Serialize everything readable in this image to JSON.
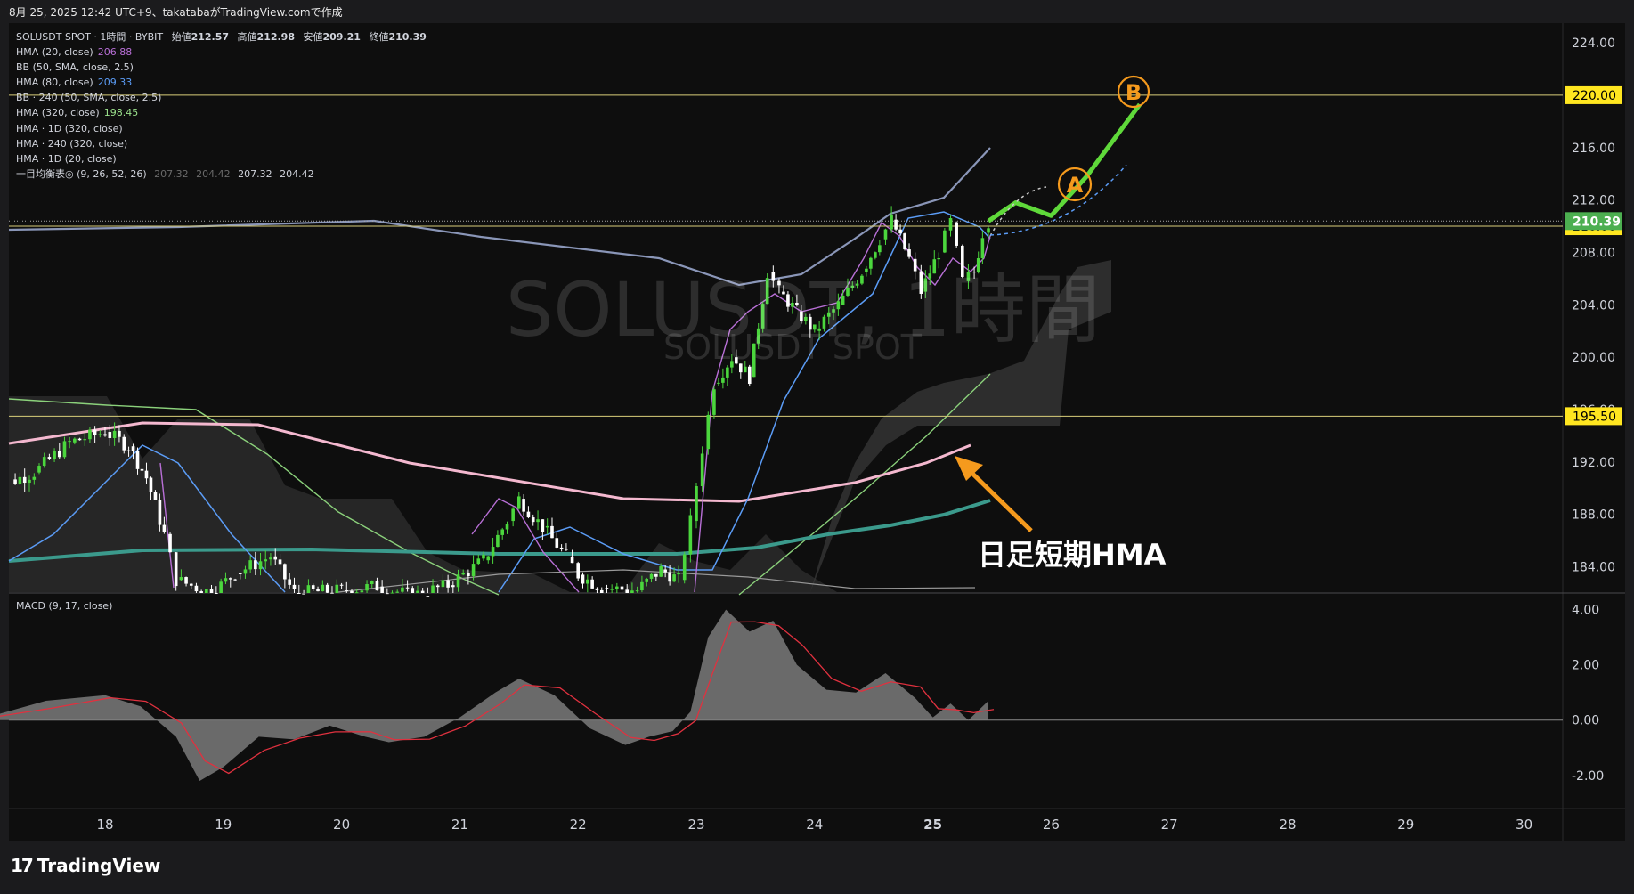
{
  "header": {
    "text": "8月 25, 2025 12:42 UTC+9、takatabaがTradingView.comで作成"
  },
  "symbol_line": {
    "name": "SOLUSDT SPOT · 1時間 · BYBIT",
    "o_label": "始値",
    "o": "212.57",
    "h_label": "高値",
    "h": "212.98",
    "l_label": "安値",
    "l": "209.21",
    "c_label": "終値",
    "c": "210.39"
  },
  "legend": [
    {
      "label": "HMA (20, close)",
      "value": "206.88",
      "color": "#b86fd6"
    },
    {
      "label": "BB (50, SMA, close, 2.5)",
      "value": "",
      "color": "#d1d4dc"
    },
    {
      "label": "HMA (80, close)",
      "value": "209.33",
      "color": "#5b9cf6"
    },
    {
      "label": "BB · 240 (50, SMA, close, 2.5)",
      "value": "",
      "color": "#d1d4dc"
    },
    {
      "label": "HMA (320, close)",
      "value": "198.45",
      "color": "#9be28c"
    },
    {
      "label": "HMA · 1D (320, close)",
      "value": "",
      "color": "#d1d4dc"
    },
    {
      "label": "HMA · 240 (320, close)",
      "value": "",
      "color": "#d1d4dc"
    },
    {
      "label": "HMA · 1D (20, close)",
      "value": "",
      "color": "#d1d4dc"
    }
  ],
  "ichimoku": {
    "label": "一目均衡表◎ (9, 26, 52, 26)",
    "v1": "207.32",
    "v2": "204.42",
    "v3": "207.32",
    "v4": "204.42"
  },
  "macd": {
    "label": "MACD (9, 17, close)"
  },
  "watermark": {
    "line1": "SOLUSDT, 1時間",
    "line2": "SOLUSDT SPOT"
  },
  "annotation": {
    "text": "日足短期HMA"
  },
  "markers": {
    "a": "A",
    "b": "B"
  },
  "colors": {
    "background": "#0e0e0e",
    "up": "#4bd63d",
    "down": "#ffffff",
    "hline": "#d9cf7a",
    "current": "#4caf50",
    "macd_hist": "#7a7a7a",
    "signal": "#e0313f",
    "arrow": "#f59a1d",
    "pink": "#f4b8cf",
    "teal": "#3b9a8c"
  },
  "chart_data": {
    "type": "candlestick",
    "price_axis": {
      "ticks": [
        "224.00",
        "220.00",
        "216.00",
        "212.00",
        "208.00",
        "204.00",
        "200.00",
        "196.00",
        "192.00",
        "188.00",
        "184.00"
      ],
      "ylim": [
        182.0,
        225.5
      ]
    },
    "x_axis": {
      "ticks": [
        "18",
        "19",
        "20",
        "21",
        "22",
        "23",
        "24",
        "25",
        "26",
        "27",
        "28",
        "29",
        "30"
      ]
    },
    "horizontal_levels": [
      {
        "value": 220.0,
        "label": "220.00"
      },
      {
        "value": 210.0,
        "label": "210.00"
      },
      {
        "value": 195.5,
        "label": "195.50"
      }
    ],
    "current_price": {
      "value": 210.39,
      "label": "210.39"
    },
    "macd_axis": {
      "ticks": [
        "4.00",
        "2.00",
        "0.00",
        "-2.00"
      ],
      "ylim": [
        -3.2,
        4.6
      ]
    },
    "price_path": [
      [
        17.0,
        189.8
      ],
      [
        17.4,
        191.2
      ],
      [
        17.7,
        193.5
      ],
      [
        18.0,
        194.3
      ],
      [
        18.2,
        193.2
      ],
      [
        18.35,
        190.8
      ],
      [
        18.5,
        186.5
      ],
      [
        18.6,
        183.0
      ],
      [
        18.9,
        182.0
      ],
      [
        19.1,
        183.5
      ],
      [
        19.4,
        184.8
      ],
      [
        19.6,
        182.0
      ],
      [
        20.0,
        182.2
      ],
      [
        20.3,
        182.5
      ],
      [
        20.6,
        181.8
      ],
      [
        20.9,
        182.6
      ],
      [
        21.2,
        184.5
      ],
      [
        21.4,
        187.5
      ],
      [
        21.5,
        189.2
      ],
      [
        21.7,
        187.0
      ],
      [
        21.9,
        184.8
      ],
      [
        22.0,
        183.4
      ],
      [
        22.2,
        182.4
      ],
      [
        22.5,
        182.2
      ],
      [
        22.7,
        183.8
      ],
      [
        22.85,
        183.0
      ],
      [
        22.95,
        187.5
      ],
      [
        23.05,
        193.0
      ],
      [
        23.15,
        198.0
      ],
      [
        23.3,
        200.0
      ],
      [
        23.45,
        198.5
      ],
      [
        23.6,
        206.5
      ],
      [
        23.7,
        205.0
      ],
      [
        23.85,
        203.5
      ],
      [
        24.0,
        202.0
      ],
      [
        24.2,
        204.0
      ],
      [
        24.4,
        206.5
      ],
      [
        24.55,
        209.0
      ],
      [
        24.65,
        210.5
      ],
      [
        24.8,
        207.5
      ],
      [
        24.9,
        205.0
      ],
      [
        25.05,
        208.0
      ],
      [
        25.15,
        210.3
      ],
      [
        25.25,
        205.8
      ],
      [
        25.35,
        206.5
      ],
      [
        25.42,
        209.5
      ],
      [
        25.47,
        210.39
      ]
    ],
    "scenario_path": [
      [
        25.47,
        210.39
      ],
      [
        25.7,
        211.8
      ],
      [
        26.0,
        210.8
      ],
      [
        26.3,
        213.8
      ],
      [
        26.75,
        219.3
      ]
    ],
    "macd_hist_path": [
      [
        17.0,
        0.1
      ],
      [
        17.5,
        0.7
      ],
      [
        18.0,
        0.9
      ],
      [
        18.3,
        0.5
      ],
      [
        18.6,
        -0.6
      ],
      [
        18.8,
        -2.2
      ],
      [
        19.0,
        -1.7
      ],
      [
        19.3,
        -0.6
      ],
      [
        19.6,
        -0.7
      ],
      [
        19.9,
        -0.2
      ],
      [
        20.2,
        -0.6
      ],
      [
        20.4,
        -0.8
      ],
      [
        20.7,
        -0.6
      ],
      [
        21.0,
        0.1
      ],
      [
        21.3,
        1.0
      ],
      [
        21.5,
        1.5
      ],
      [
        21.8,
        0.9
      ],
      [
        22.1,
        -0.3
      ],
      [
        22.4,
        -0.9
      ],
      [
        22.6,
        -0.6
      ],
      [
        22.8,
        -0.4
      ],
      [
        22.95,
        0.3
      ],
      [
        23.1,
        3.0
      ],
      [
        23.25,
        4.0
      ],
      [
        23.45,
        3.2
      ],
      [
        23.65,
        3.6
      ],
      [
        23.85,
        2.0
      ],
      [
        24.1,
        1.1
      ],
      [
        24.35,
        1.0
      ],
      [
        24.6,
        1.7
      ],
      [
        24.85,
        0.8
      ],
      [
        25.0,
        0.1
      ],
      [
        25.15,
        0.6
      ],
      [
        25.3,
        0.0
      ],
      [
        25.47,
        0.7
      ]
    ]
  }
}
